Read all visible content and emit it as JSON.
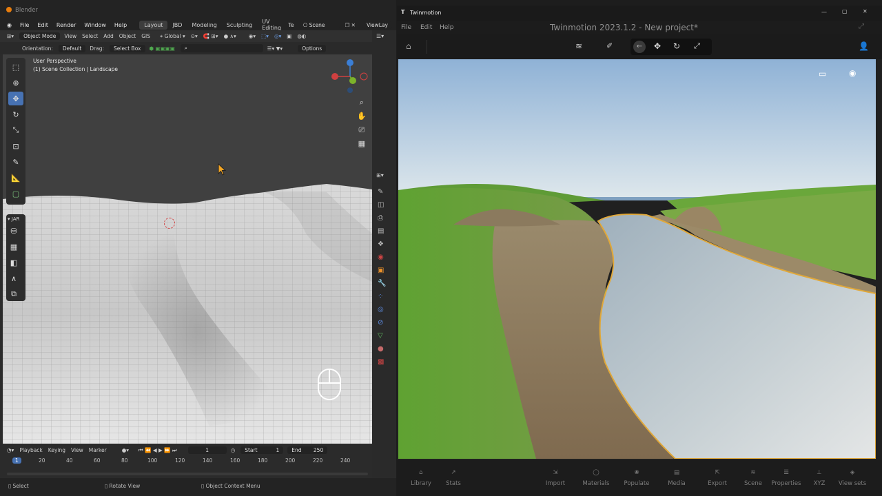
{
  "blender": {
    "title": "Blender",
    "menu": [
      "File",
      "Edit",
      "Render",
      "Window",
      "Help"
    ],
    "workspaces": [
      "Layout",
      "JBD",
      "Modeling",
      "Sculpting",
      "UV Editing",
      "Te"
    ],
    "active_workspace": "Layout",
    "scene_label": "Scene",
    "view_layer_label": "ViewLay",
    "header": {
      "mode": "Object Mode",
      "view": "View",
      "select": "Select",
      "add": "Add",
      "object": "Object",
      "gis": "GIS",
      "transform": "Global"
    },
    "header2": {
      "orientation_label": "Orientation:",
      "orientation": "Default",
      "drag_label": "Drag:",
      "drag": "Select Box",
      "options": "Options"
    },
    "viewport": {
      "perspective": "User Perspective",
      "collection": "(1) Scene Collection | Landscape"
    },
    "jar_label": "JAR",
    "timeline": {
      "playback": "Playback",
      "keying": "Keying",
      "view": "View",
      "marker": "Marker",
      "current_frame": "1",
      "start_label": "Start",
      "start": "1",
      "end_label": "End",
      "end": "250",
      "frames": [
        "1",
        "20",
        "40",
        "60",
        "80",
        "100",
        "120",
        "140",
        "160",
        "180",
        "200",
        "220",
        "240"
      ]
    },
    "status": {
      "select": "Select",
      "rotate": "Rotate View",
      "context": "Object Context Menu"
    }
  },
  "twinmotion": {
    "window_title": "Twinmotion",
    "project_title": "Twinmotion 2023.1.2 - New project*",
    "menu": [
      "File",
      "Edit",
      "Help"
    ],
    "bottom_left": [
      {
        "label": "Library",
        "icon": "library-icon"
      },
      {
        "label": "Stats",
        "icon": "stats-icon"
      }
    ],
    "bottom_right": [
      {
        "label": "Import",
        "icon": "import-icon"
      },
      {
        "label": "Materials",
        "icon": "materials-icon"
      },
      {
        "label": "Populate",
        "icon": "populate-icon"
      },
      {
        "label": "Media",
        "icon": "media-icon"
      },
      {
        "label": "Export",
        "icon": "export-icon"
      },
      {
        "label": "Scene",
        "icon": "scene-icon"
      },
      {
        "label": "Properties",
        "icon": "properties-icon"
      },
      {
        "label": "XYZ",
        "icon": "xyz-icon"
      },
      {
        "label": "View sets",
        "icon": "view-sets-icon"
      }
    ]
  },
  "colors": {
    "blender_accent": "#4772b3",
    "grass": "#6fa83a",
    "water": "#b9c3c8",
    "sky": "#a9c5e3"
  }
}
